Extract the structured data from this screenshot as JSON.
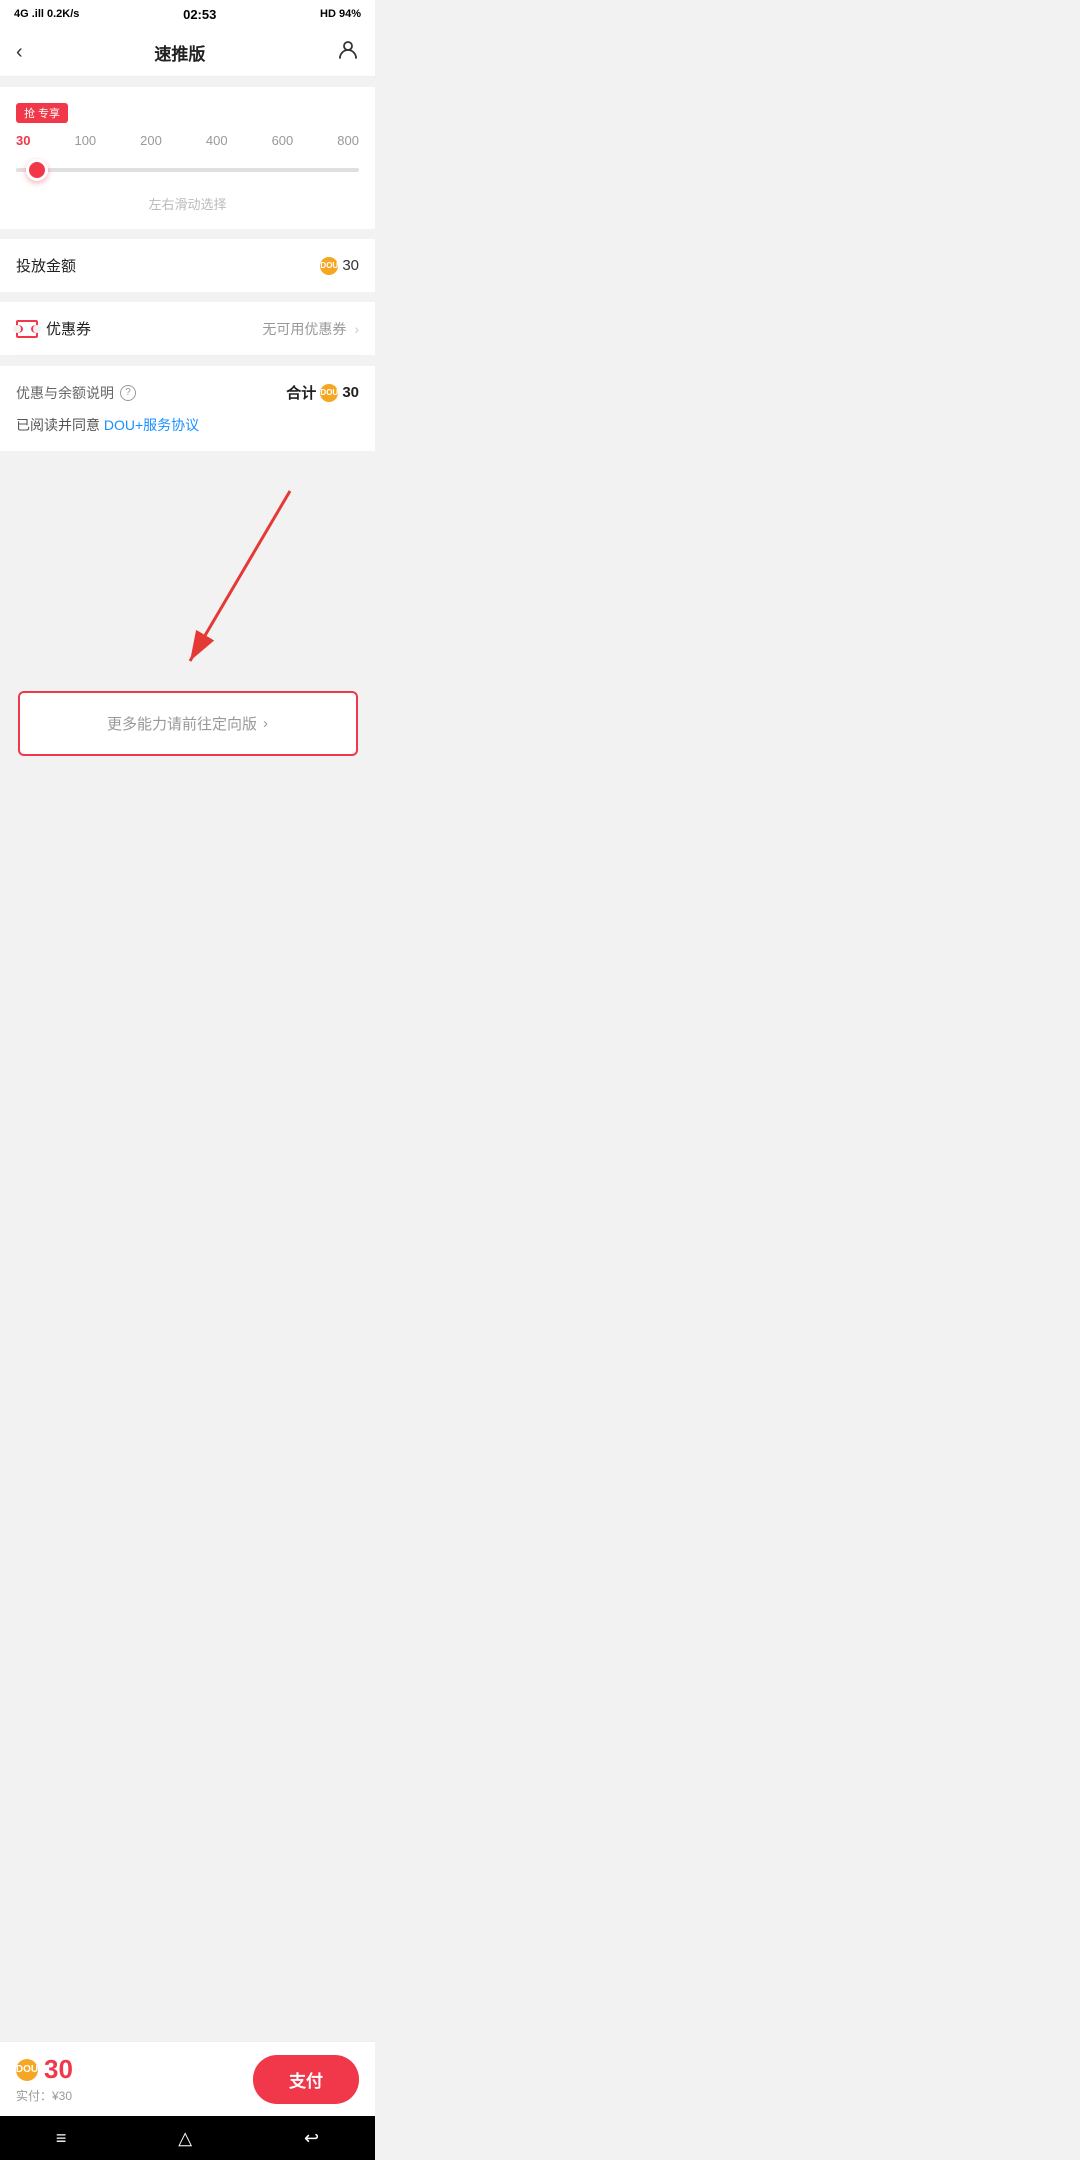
{
  "statusBar": {
    "left": "4G .ill 0.2K/s",
    "center": "02:53",
    "right": "HD  94%"
  },
  "navBar": {
    "backIcon": "‹",
    "title": "速推版",
    "userIcon": "👤"
  },
  "sliderCard": {
    "badge": "抢 专享",
    "labels": [
      "30",
      "100",
      "200",
      "400",
      "600",
      "800"
    ],
    "activeIndex": 0,
    "hint": "左右滑动选择"
  },
  "budgetRow": {
    "label": "投放金额",
    "coinValue": "30"
  },
  "couponRow": {
    "label": "优惠券",
    "value": "无可用优惠券"
  },
  "summaryRow": {
    "label": "优惠与余额说明",
    "helpIcon": "?",
    "totalLabel": "合计",
    "totalValue": "30"
  },
  "agreementRow": {
    "prefix": "已阅读并同意 ",
    "linkText": "DOU+服务协议"
  },
  "moreBtn": {
    "text": "更多能力请前往定向版",
    "chevron": "›"
  },
  "bottomBar": {
    "priceNum": "30",
    "priceSub": "实付：¥30",
    "payLabel": "支付"
  },
  "homeBar": {
    "icons": [
      "≡",
      "△",
      "↩"
    ]
  }
}
